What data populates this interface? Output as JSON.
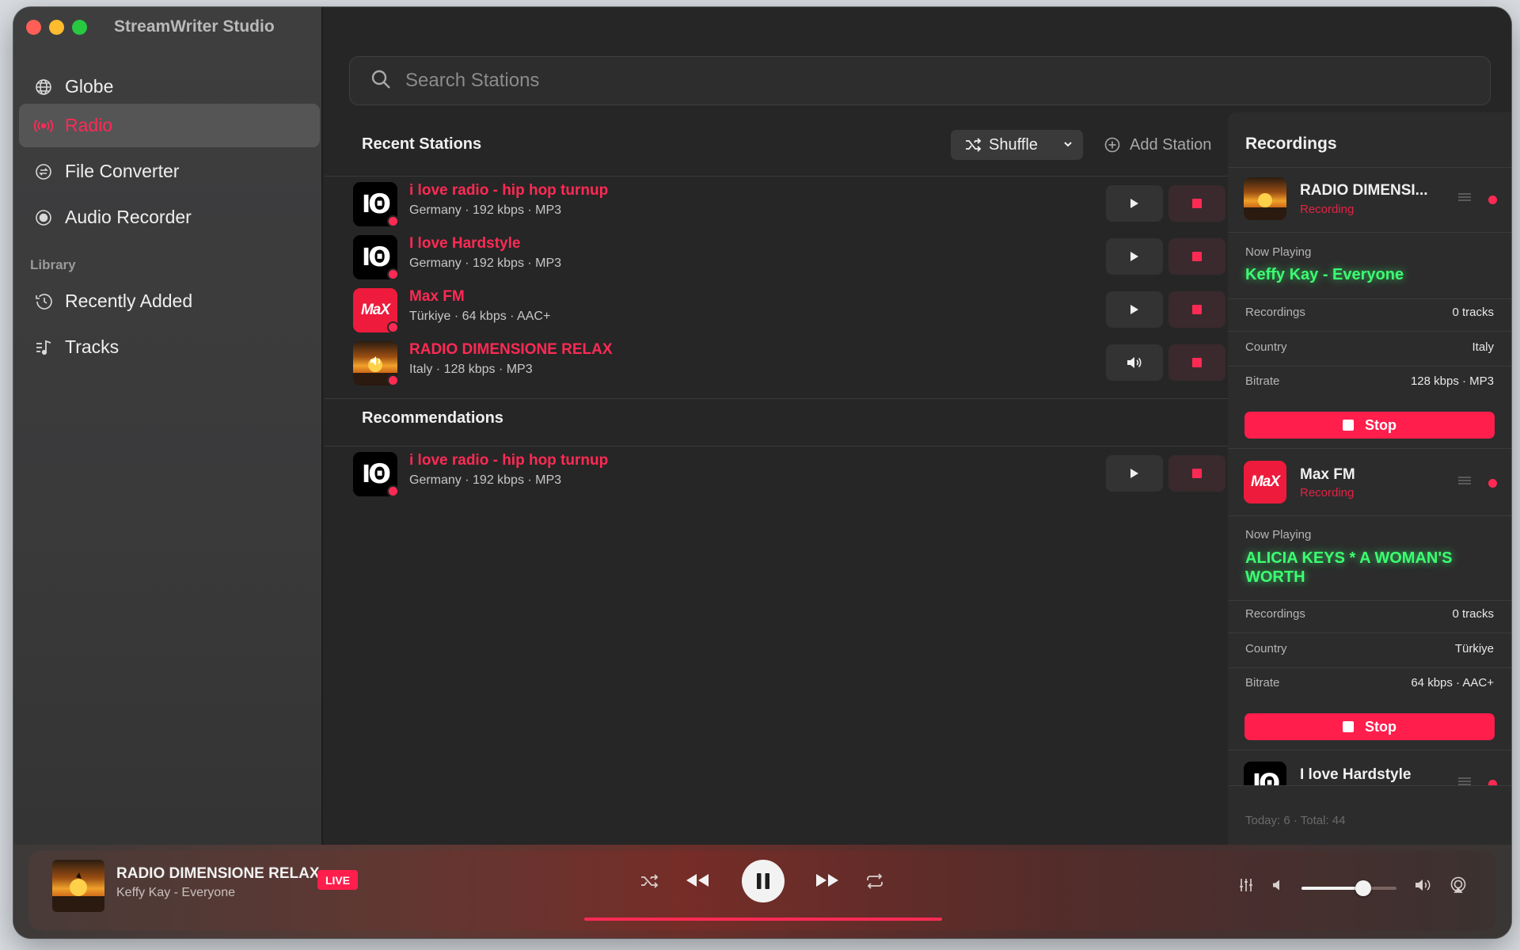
{
  "app": {
    "title": "StreamWriter Studio"
  },
  "sidebar": {
    "items": [
      {
        "label": "Globe",
        "icon": "globe-icon"
      },
      {
        "label": "Radio",
        "icon": "radio-waves-icon",
        "active": true
      },
      {
        "label": "File Converter",
        "icon": "convert-icon"
      },
      {
        "label": "Audio Recorder",
        "icon": "record-icon"
      }
    ],
    "library_header": "Library",
    "library_items": [
      {
        "label": "Recently Added",
        "icon": "clock-history-icon"
      },
      {
        "label": "Tracks",
        "icon": "music-list-icon"
      }
    ]
  },
  "search": {
    "placeholder": "Search Stations"
  },
  "recent": {
    "title": "Recent Stations",
    "shuffle_label": "Shuffle",
    "add_station_label": "Add Station",
    "stations": [
      {
        "name": "i love radio - hip hop turnup",
        "meta": "Germany · 192 kbps · MP3",
        "logo": "ilr",
        "state": "play"
      },
      {
        "name": "I love Hardstyle",
        "meta": "Germany · 192 kbps · MP3",
        "logo": "ilr",
        "state": "play"
      },
      {
        "name": "Max FM",
        "meta": "Türkiye · 64 kbps · AAC+",
        "logo": "max",
        "logo_text": "MaX",
        "state": "play"
      },
      {
        "name": "RADIO DIMENSIONE RELAX",
        "meta": "Italy · 128 kbps · MP3",
        "logo": "rdr",
        "state": "playing"
      }
    ]
  },
  "recommendations": {
    "title": "Recommendations",
    "stations": [
      {
        "name": "i love radio - hip hop turnup",
        "meta": "Germany · 192 kbps · MP3",
        "logo": "ilr",
        "state": "play"
      }
    ]
  },
  "recordings": {
    "title": "Recordings",
    "cards": [
      {
        "name": "RADIO DIMENSI...",
        "status": "Recording",
        "now_playing_label": "Now Playing",
        "now_playing": "Keffy Kay - Everyone",
        "rows": [
          {
            "label": "Recordings",
            "value": "0 tracks"
          },
          {
            "label": "Country",
            "value": "Italy"
          },
          {
            "label": "Bitrate",
            "value": "128 kbps · MP3"
          }
        ],
        "stop_label": "Stop"
      },
      {
        "name": "Max FM",
        "status": "Recording",
        "now_playing_label": "Now Playing",
        "now_playing": "ALICIA KEYS * A WOMAN'S WORTH",
        "rows": [
          {
            "label": "Recordings",
            "value": "0 tracks"
          },
          {
            "label": "Country",
            "value": "Türkiye"
          },
          {
            "label": "Bitrate",
            "value": "64 kbps · AAC+"
          }
        ],
        "stop_label": "Stop"
      },
      {
        "name": "I love Hardstyle"
      }
    ],
    "footer": "Today: 6 · Total: 44"
  },
  "player": {
    "title": "RADIO DIMENSIONE RELAX",
    "artist": "Keffy Kay - Everyone",
    "live_label": "LIVE",
    "volume": 0.65
  },
  "colors": {
    "accent": "#ff2a54",
    "now_playing": "#3cff72",
    "stop_button": "#ff1e4c"
  }
}
